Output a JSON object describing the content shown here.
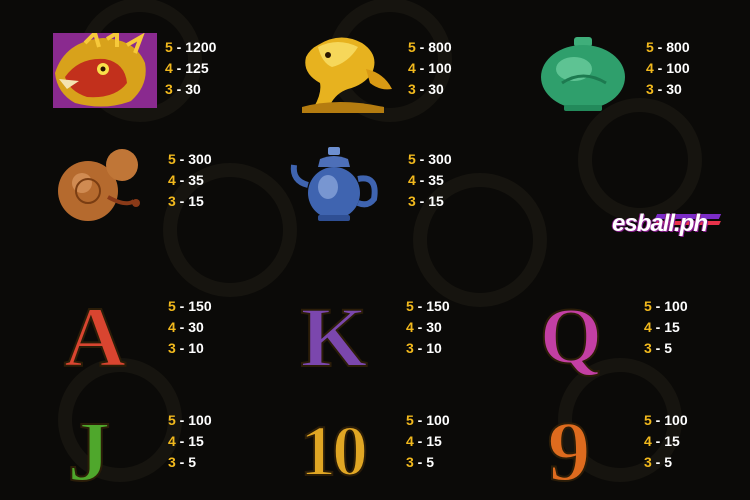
{
  "paytable": {
    "dragon": {
      "icon": "dragon-head-icon",
      "pays": [
        {
          "count": "5",
          "amount": "1200"
        },
        {
          "count": "4",
          "amount": "125"
        },
        {
          "count": "3",
          "amount": "30"
        }
      ]
    },
    "carp": {
      "icon": "golden-carp-icon",
      "pays": [
        {
          "count": "5",
          "amount": "800"
        },
        {
          "count": "4",
          "amount": "100"
        },
        {
          "count": "3",
          "amount": "30"
        }
      ]
    },
    "vase": {
      "icon": "jade-vase-icon",
      "pays": [
        {
          "count": "5",
          "amount": "800"
        },
        {
          "count": "4",
          "amount": "100"
        },
        {
          "count": "3",
          "amount": "30"
        }
      ]
    },
    "gourd": {
      "icon": "gourd-icon",
      "pays": [
        {
          "count": "5",
          "amount": "300"
        },
        {
          "count": "4",
          "amount": "35"
        },
        {
          "count": "3",
          "amount": "15"
        }
      ]
    },
    "teapot": {
      "icon": "porcelain-teapot-icon",
      "pays": [
        {
          "count": "5",
          "amount": "300"
        },
        {
          "count": "4",
          "amount": "35"
        },
        {
          "count": "3",
          "amount": "15"
        }
      ]
    },
    "a": {
      "glyph": "A",
      "pays": [
        {
          "count": "5",
          "amount": "150"
        },
        {
          "count": "4",
          "amount": "30"
        },
        {
          "count": "3",
          "amount": "10"
        }
      ]
    },
    "k": {
      "glyph": "K",
      "pays": [
        {
          "count": "5",
          "amount": "150"
        },
        {
          "count": "4",
          "amount": "30"
        },
        {
          "count": "3",
          "amount": "10"
        }
      ]
    },
    "q": {
      "glyph": "Q",
      "pays": [
        {
          "count": "5",
          "amount": "100"
        },
        {
          "count": "4",
          "amount": "15"
        },
        {
          "count": "3",
          "amount": "5"
        }
      ]
    },
    "j": {
      "glyph": "J",
      "pays": [
        {
          "count": "5",
          "amount": "100"
        },
        {
          "count": "4",
          "amount": "15"
        },
        {
          "count": "3",
          "amount": "5"
        }
      ]
    },
    "ten": {
      "glyph": "10",
      "pays": [
        {
          "count": "5",
          "amount": "100"
        },
        {
          "count": "4",
          "amount": "15"
        },
        {
          "count": "3",
          "amount": "5"
        }
      ]
    },
    "nine": {
      "glyph": "9",
      "pays": [
        {
          "count": "5",
          "amount": "100"
        },
        {
          "count": "4",
          "amount": "15"
        },
        {
          "count": "3",
          "amount": "5"
        }
      ]
    }
  },
  "separator": " - ",
  "watermark": {
    "text": "esball.ph"
  },
  "colors": {
    "background": "#0b0a08",
    "count": "#f2b91d",
    "amount": "#ffffff"
  }
}
